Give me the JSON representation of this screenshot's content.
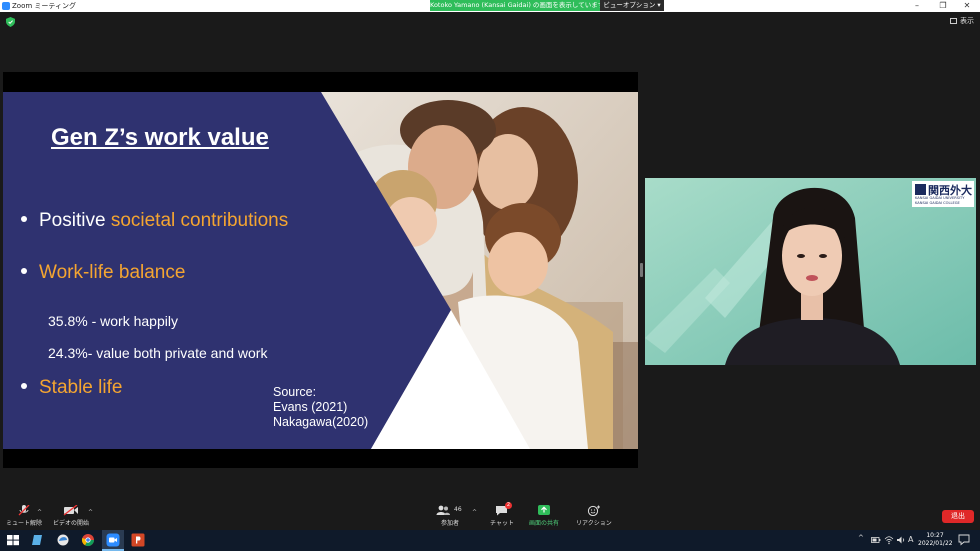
{
  "window": {
    "title": "Zoom ミーティング",
    "share_banner": "Kotoko Yamano (Kansai Gaidai) の画面を表示しています",
    "view_options": "ビューオプション ▾",
    "controls": {
      "minimize": "–",
      "restore": "❐",
      "close": "✕"
    }
  },
  "top_bar": {
    "view_label": "表示"
  },
  "slide": {
    "title": "Gen Z’s work value",
    "bullets": [
      {
        "plain": "Positive ",
        "highlight": "societal contributions"
      },
      {
        "plain": "",
        "highlight": "Work-life balance"
      },
      {
        "plain": "",
        "highlight": "Stable life"
      }
    ],
    "sub_points": [
      "35.8% - work happily",
      "24.3%- value both private and work"
    ],
    "source": [
      "Source:",
      "Evans (2021)",
      "Nakagawa(2020)"
    ]
  },
  "video": {
    "logo_main": "関西外大",
    "logo_sub1": "KANSAI GAIDAI UNIVERSITY",
    "logo_sub2": "KANSAI GAIDAI COLLEGE"
  },
  "toolbar": {
    "mute": "ミュート解除",
    "video": "ビデオの開始",
    "participants": "参加者",
    "participants_count": "46",
    "chat": "チャット",
    "chat_badge": "2",
    "share": "画面の共有",
    "reactions": "リアクション",
    "leave": "退出"
  },
  "taskbar": {
    "time": "10:27",
    "date": "2022/01/22",
    "ime": "A"
  },
  "colors": {
    "slide_navy": "#2f3270",
    "accent_orange": "#f4a531",
    "share_green": "#2fbd5a",
    "leave_red": "#e02828",
    "video_bg": "#8fd0c0"
  }
}
